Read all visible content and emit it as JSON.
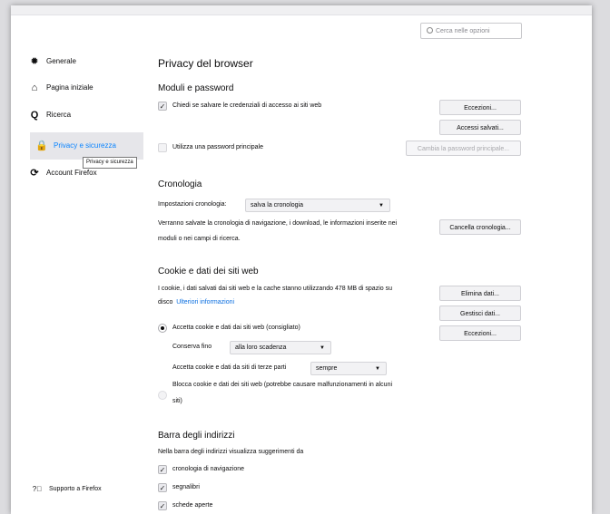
{
  "search": {
    "placeholder": "Cerca nelle opzioni"
  },
  "sidebar": {
    "items": [
      {
        "label": "Generale",
        "icon": "gear-icon"
      },
      {
        "label": "Pagina iniziale",
        "icon": "home-icon"
      },
      {
        "label": "Ricerca",
        "icon": "search-icon"
      },
      {
        "label": "Privacy e sicurezza",
        "icon": "lock-icon"
      },
      {
        "label": "Account Firefox",
        "icon": "sync-icon"
      }
    ],
    "tooltip": "Privacy e sicurezza",
    "support": {
      "label": "Supporto a Firefox",
      "icon": "help-icon"
    }
  },
  "page_title": "Privacy del browser",
  "logins": {
    "heading": "Moduli e password",
    "ask_save": {
      "label": "Chiedi se salvare le credenziali di accesso ai siti web",
      "checked": true
    },
    "exceptions_btn": "Eccezioni...",
    "saved_logins_btn": "Accessi salvati...",
    "master_password": {
      "label": "Utilizza una password principale",
      "checked": false
    },
    "change_master_btn": "Cambia la password principale..."
  },
  "history": {
    "heading": "Cronologia",
    "settings_label": "Impostazioni cronologia:",
    "settings_value": "salva la cronologia",
    "desc_line1": "Verranno salvate la cronologia di navigazione, i download, le informazioni inserite nei",
    "desc_line2": "moduli o nei campi di ricerca.",
    "clear_btn": "Cancella cronologia..."
  },
  "cookies": {
    "heading": "Cookie e dati dei siti web",
    "desc_line1": "I cookie, i dati salvati dai siti web e la cache stanno utilizzando 478 MB di spazio su",
    "desc_line2": "disco",
    "learn_more": "Ulteriori informazioni",
    "clear_btn": "Elimina dati...",
    "manage_btn": "Gestisci dati...",
    "exceptions_btn": "Eccezioni...",
    "accept_radio": "Accetta cookie e dati dai siti web (consigliato)",
    "keep_label": "Conserva fino",
    "keep_value": "alla loro scadenza",
    "third_party_label": "Accetta cookie e dati da siti di terze parti",
    "third_party_value": "sempre",
    "block_radio_line1": "Blocca cookie e dati dei siti web (potrebbe causare malfunzionamenti in alcuni",
    "block_radio_line2": "siti)"
  },
  "address_bar": {
    "heading": "Barra degli indirizzi",
    "desc": "Nella barra degli indirizzi visualizza suggerimenti da",
    "options": [
      {
        "label": "cronologia di navigazione",
        "checked": true
      },
      {
        "label": "segnalibri",
        "checked": true
      },
      {
        "label": "schede aperte",
        "checked": true
      }
    ]
  },
  "colors": {
    "accent": "#0a84ff",
    "sidebar_active_bg": "#e6e6ea"
  }
}
